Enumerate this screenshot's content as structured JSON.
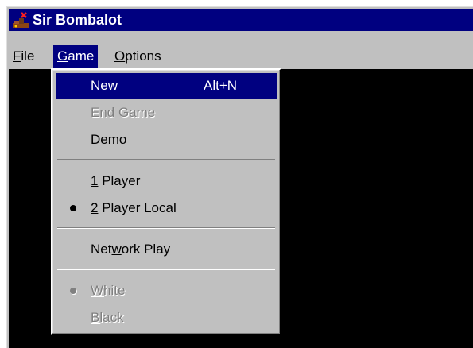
{
  "window": {
    "title": "Sir Bombalot",
    "icon": "cannon-icon",
    "colors": {
      "title_bar": "#000080",
      "face": "#c0c0c0",
      "game_area": "#000000",
      "highlight": "#000080",
      "disabled_text": "#808080"
    }
  },
  "menubar": {
    "items": [
      {
        "label": "File",
        "mnemonic": "F",
        "rest": "ile"
      },
      {
        "label": "Game",
        "mnemonic": "G",
        "rest": "ame",
        "open": true
      },
      {
        "label": "Options",
        "mnemonic": "O",
        "rest": "ptions"
      }
    ]
  },
  "game_menu": {
    "new": {
      "label": "New",
      "mnemonic": "N",
      "rest": "ew",
      "shortcut": "Alt+N",
      "highlighted": true
    },
    "end_game": {
      "label": "End Game",
      "enabled": false
    },
    "demo": {
      "label": "Demo",
      "mnemonic": "D",
      "rest": "emo"
    },
    "one_player": {
      "label": "1 Player",
      "mnemonic": "1",
      "rest": " Player"
    },
    "two_player_local": {
      "label": "2 Player Local",
      "mnemonic": "2",
      "rest": " Player Local",
      "checked": true
    },
    "network_play": {
      "label": "Network Play",
      "pre": "Net",
      "mnemonic": "w",
      "rest": "ork Play"
    },
    "white": {
      "label": "White",
      "mnemonic": "W",
      "rest": "hite",
      "checked": true,
      "enabled": false
    },
    "black": {
      "label": "Black",
      "mnemonic": "B",
      "rest": "lack",
      "enabled": false
    }
  }
}
